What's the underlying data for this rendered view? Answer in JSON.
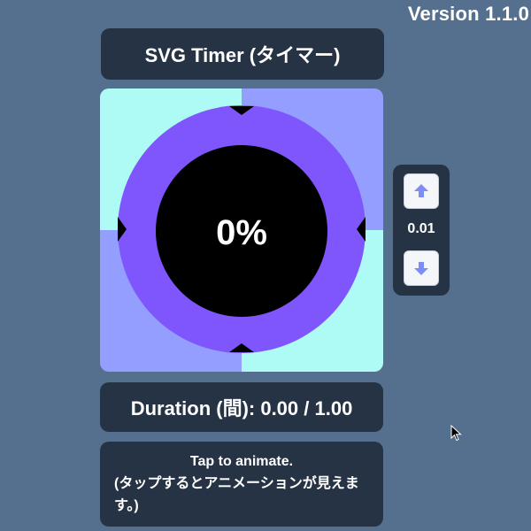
{
  "version": "Version 1.1.0",
  "title": "SVG Timer (タイマー)",
  "timer": {
    "percent_label": "0%",
    "progress": 0
  },
  "stepper": {
    "value": "0.01",
    "up_icon": "arrow-up-icon",
    "down_icon": "arrow-down-icon"
  },
  "duration": {
    "text": "Duration (間): 0.00 / 1.00"
  },
  "info": {
    "line1": "Tap to animate.",
    "line2": "(タップするとアニメーションが見えます。)"
  },
  "colors": {
    "page_background": "#55708f",
    "panel_background": "#263344",
    "quadrant_cyan": "#aefaf5",
    "quadrant_periwinkle": "#949efe",
    "ring_purple": "#7f56fb",
    "center_black": "#000000",
    "button_arrow": "#7c8ef5"
  }
}
